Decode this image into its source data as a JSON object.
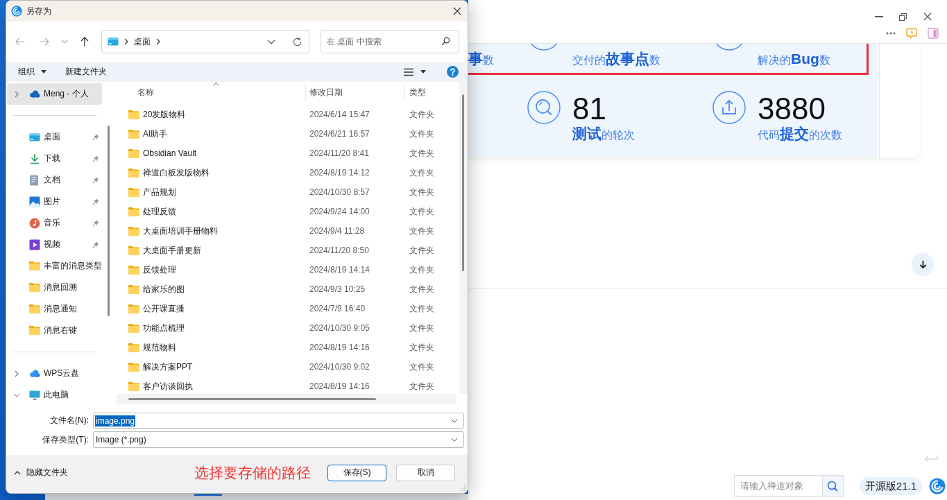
{
  "dialog": {
    "title": "另存为",
    "nav_buttons": [
      {
        "kind": "back",
        "disabled": true
      },
      {
        "kind": "forward",
        "disabled": true
      },
      {
        "kind": "recent",
        "disabled": true
      },
      {
        "kind": "up",
        "disabled": false
      }
    ],
    "address": {
      "path": [
        "桌面"
      ]
    },
    "search": {
      "placeholder": "在 桌面 中搜索"
    },
    "toolbar": {
      "organize": "组织",
      "new_folder": "新建文件夹"
    },
    "sidebar": {
      "groups": [
        {
          "items": [
            {
              "label": "Meng - 个人",
              "kind": "onedrive",
              "expanded": false,
              "selected": true
            }
          ]
        },
        {
          "items": [
            {
              "label": "桌面",
              "kind": "desktop",
              "pinned": true,
              "selected": false
            },
            {
              "label": "下载",
              "kind": "downloads",
              "pinned": true,
              "selected": false
            },
            {
              "label": "文档",
              "kind": "documents",
              "pinned": true,
              "selected": false
            },
            {
              "label": "图片",
              "kind": "pictures",
              "pinned": true,
              "selected": false
            },
            {
              "label": "音乐",
              "kind": "music",
              "pinned": true,
              "selected": false
            },
            {
              "label": "视频",
              "kind": "videos",
              "pinned": true,
              "selected": false
            },
            {
              "label": "丰富的消息类型",
              "kind": "folder",
              "pinned": false,
              "selected": false
            },
            {
              "label": "消息回溯",
              "kind": "folder",
              "pinned": false,
              "selected": false
            },
            {
              "label": "消息通知",
              "kind": "folder",
              "pinned": false,
              "selected": false
            },
            {
              "label": "消息右键",
              "kind": "folder",
              "pinned": false,
              "selected": false
            }
          ]
        },
        {
          "items": [
            {
              "label": "WPS云盘",
              "kind": "wps",
              "expanded": false,
              "selected": false
            },
            {
              "label": "此电脑",
              "kind": "pc",
              "expanded": true,
              "selected": false
            }
          ]
        }
      ]
    },
    "columns": [
      {
        "label": "名称",
        "sorted": true
      },
      {
        "label": "修改日期",
        "sorted": false
      },
      {
        "label": "类型",
        "sorted": false
      }
    ],
    "rows": [
      {
        "name": "20发版物料",
        "modified": "2024/6/14 15:47",
        "type": "文件夹",
        "selected": false
      },
      {
        "name": "AI助手",
        "modified": "2024/6/21 16:57",
        "type": "文件夹",
        "selected": false
      },
      {
        "name": "Obsidian Vault",
        "modified": "2024/11/20 8:41",
        "type": "文件夹",
        "selected": false
      },
      {
        "name": "禅道白板发版物料",
        "modified": "2024/8/19 14:12",
        "type": "文件夹",
        "selected": false
      },
      {
        "name": "产品规划",
        "modified": "2024/10/30 8:57",
        "type": "文件夹",
        "selected": false
      },
      {
        "name": "处理反馈",
        "modified": "2024/9/24 14:00",
        "type": "文件夹",
        "selected": false
      },
      {
        "name": "大桌面培训手册物料",
        "modified": "2024/9/4 11:28",
        "type": "文件夹",
        "selected": false
      },
      {
        "name": "大桌面手册更新",
        "modified": "2024/11/20 8:50",
        "type": "文件夹",
        "selected": false
      },
      {
        "name": "反馈处理",
        "modified": "2024/8/19 14:14",
        "type": "文件夹",
        "selected": false
      },
      {
        "name": "给家乐的图",
        "modified": "2024/9/3 10:25",
        "type": "文件夹",
        "selected": false
      },
      {
        "name": "公开课直播",
        "modified": "2024/7/9 16:40",
        "type": "文件夹",
        "selected": false
      },
      {
        "name": "功能点梳理",
        "modified": "2024/10/30 9:05",
        "type": "文件夹",
        "selected": false
      },
      {
        "name": "规范物料",
        "modified": "2024/8/19 14:16",
        "type": "文件夹",
        "selected": false
      },
      {
        "name": "解决方案PPT",
        "modified": "2024/10/30 9:02",
        "type": "文件夹",
        "selected": false
      },
      {
        "name": "客户访谈回执",
        "modified": "2024/8/19 14:16",
        "type": "文件夹",
        "selected": false
      }
    ],
    "fields": [
      {
        "label": "文件名(N):",
        "value": "image.png",
        "highlighted": true
      },
      {
        "label": "保存类型(T):",
        "value": "Image (*.png)",
        "highlighted": false
      }
    ],
    "hide_folders": "隐藏文件夹",
    "annotation": "选择要存储的路径",
    "buttons": [
      {
        "label": "保存(S)",
        "default": true
      },
      {
        "label": "取消",
        "default": false
      }
    ]
  },
  "app": {
    "stats_row_1": [
      {
        "label": "**事**数",
        "icon_visible": false
      },
      {
        "label": "交付的**故事点**数",
        "icon_visible": true
      },
      {
        "label": "解决的**Bug**数",
        "icon_visible": true
      }
    ],
    "stats_row_2": [
      {
        "value": "81",
        "label": "**测试**的轮次",
        "kind": "magnifier"
      },
      {
        "value": "3880",
        "label": "代码**提交**的次数",
        "kind": "upload"
      }
    ],
    "search": {
      "placeholder": "请输入禅道对象"
    },
    "version": "开源版21.1"
  }
}
